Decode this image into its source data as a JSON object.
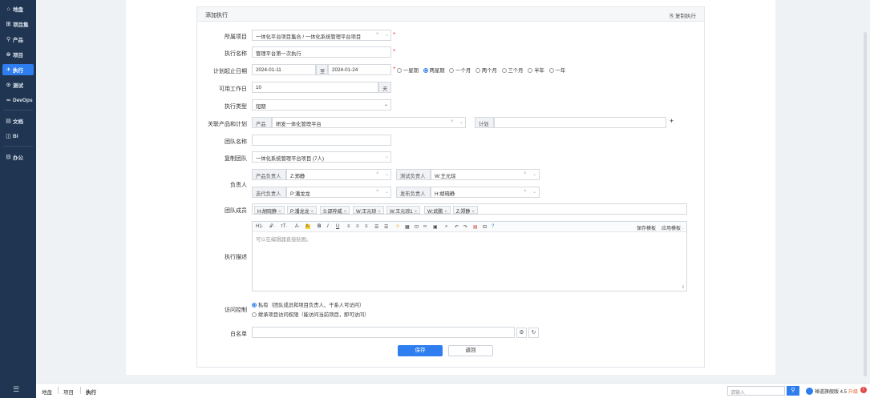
{
  "sidebar": {
    "items": [
      {
        "icon": "⌂",
        "label": "地盘"
      },
      {
        "icon": "⊞",
        "label": "项目集"
      },
      {
        "icon": "⚲",
        "label": "产品"
      },
      {
        "icon": "⊜",
        "label": "项目"
      },
      {
        "icon": "✈",
        "label": "执行"
      },
      {
        "icon": "⊙",
        "label": "测试"
      },
      {
        "icon": "∞",
        "label": "DevOps"
      },
      {
        "icon": "▤",
        "label": "文档"
      },
      {
        "icon": "◫",
        "label": "BI"
      },
      {
        "icon": "⊟",
        "label": "办公"
      }
    ],
    "toggle": "☰"
  },
  "breadcrumb": [
    "地盘",
    "项目",
    "执行"
  ],
  "bottom": {
    "search_placeholder": "请输入",
    "search_icon": "⚲",
    "brand": "禅道旗舰版 4.5",
    "upgrade": "升级",
    "alert": "!"
  },
  "panel": {
    "title": "添加执行",
    "copy_label": "⎘ 复制执行"
  },
  "form": {
    "project_label": "所属项目",
    "project_value": "一体化平台项目集合 / 一体化系统管理平台项目",
    "name_label": "执行名称",
    "name_value": "管理平台第一次执行",
    "dates_label": "计划起止日期",
    "date_begin": "2024-01-11",
    "date_sep": "至",
    "date_end": "2024-01-24",
    "date_options": [
      "一星期",
      "两星期",
      "一个月",
      "两个月",
      "三个月",
      "半年",
      "一年"
    ],
    "date_selected": 1,
    "days_label": "可用工作日",
    "days_value": "10",
    "days_unit": "天",
    "type_label": "执行类型",
    "type_value": "短期",
    "link_label": "关联产品和计划",
    "product_addon": "产品",
    "product_value": "研发一体化管理平台",
    "plan_addon": "计划",
    "plan_plus": "+",
    "team_label": "团队名称",
    "copyteam_label": "复制团队",
    "copyteam_value": "一体化系统管理平台项目 (7人)",
    "owner_label": "负责人",
    "owners": [
      {
        "role": "产品负责人",
        "value": "Z:郑静"
      },
      {
        "role": "测试负责人",
        "value": "W:王元琼"
      },
      {
        "role": "迭代负责人",
        "value": "P:潘龙龙"
      },
      {
        "role": "发布负责人",
        "value": "H:胡晓静"
      }
    ],
    "members_label": "团队成员",
    "members": [
      "H:胡晓静",
      "P:潘龙龙",
      "S:邵梓威",
      "W:王元琼",
      "W:王元琼1",
      "W:武鹏",
      "Z:郑静"
    ],
    "desc_label": "执行描述",
    "desc_placeholder": "可以在编辑器直接贴图。",
    "editor_toolbar": [
      "H1·",
      "𝒯·",
      "ᴛT·",
      "A·",
      "A·",
      "B",
      "I",
      "U",
      "≡",
      "≡",
      "≡",
      "☰",
      "☰",
      "☺",
      "▦",
      "⊡",
      "∞",
      "▣",
      "⌕",
      "↶",
      "↷",
      "▤",
      "⊟",
      "?"
    ],
    "save_template": "保存模板",
    "apply_template": "应用模板 ·",
    "acl_label": "访问控制",
    "acl_private": "私有（团队成员和项目负责人、干系人可访问）",
    "acl_inherit": "继承项目访问权限（能访问当前项目，即可访问）",
    "whitelist_label": "白名单",
    "whitelist_gear": "⚙",
    "whitelist_refresh": "↻"
  },
  "buttons": {
    "save": "保存",
    "back": "返回"
  }
}
